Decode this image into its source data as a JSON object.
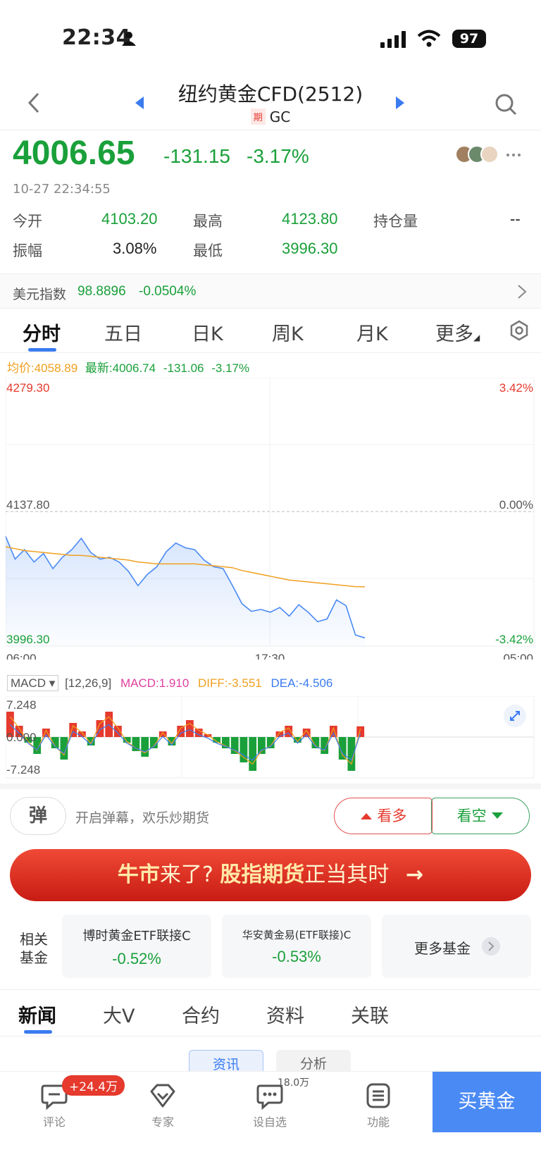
{
  "status_bar": {
    "time": "22:34",
    "battery": "97"
  },
  "nav": {
    "title": "纽约黄金CFD(2512)",
    "badge": "期",
    "code": "GC"
  },
  "quote": {
    "price": "4006.65",
    "change": "-131.15",
    "change_pct": "-3.17%",
    "timestamp": "10-27 22:34:55",
    "stats": [
      {
        "label": "今开",
        "value": "4103.20"
      },
      {
        "label": "最高",
        "value": "4123.80"
      },
      {
        "label": "持仓量",
        "value": "--"
      },
      {
        "label": "振幅",
        "value": "3.08%"
      },
      {
        "label": "最低",
        "value": "3996.30"
      }
    ]
  },
  "dollar_index": {
    "label": "美元指数",
    "value": "98.8896",
    "change_pct": "-0.0504%"
  },
  "tabs": [
    "分时",
    "五日",
    "日K",
    "周K",
    "月K",
    "更多"
  ],
  "legend": {
    "avg": "均价:4058.89",
    "latest": "最新:4006.74",
    "chg": "-131.06",
    "pct": "-3.17%"
  },
  "chart_data": [
    {
      "type": "line",
      "series": [
        {
          "name": "最新",
          "values": [
            4112,
            4088,
            4098,
            4085,
            4094,
            4078,
            4090,
            4098,
            4110,
            4095,
            4088,
            4090,
            4085,
            4075,
            4060,
            4072,
            4080,
            4096,
            4105,
            4100,
            4098,
            4087,
            4080,
            4078,
            4060,
            4041,
            4033,
            4035,
            4032,
            4037,
            4028,
            4040,
            4032,
            4022,
            4025,
            4045,
            4039,
            4008,
            4005
          ]
        },
        {
          "name": "均价",
          "values": [
            4101,
            4099,
            4097,
            4096,
            4095,
            4094,
            4093,
            4092,
            4092,
            4091,
            4090,
            4089,
            4088,
            4087,
            4085,
            4084,
            4083,
            4083,
            4083,
            4083,
            4083,
            4082,
            4081,
            4080,
            4079,
            4076,
            4074,
            4072,
            4070,
            4068,
            4066,
            4065,
            4064,
            4063,
            4062,
            4061,
            4060,
            4059,
            4058.89
          ]
        }
      ],
      "y_labels_left": [
        "4279.30",
        "4137.80",
        "3996.30"
      ],
      "y_labels_right": [
        "3.42%",
        "0.00%",
        "-3.42%"
      ],
      "x_labels": [
        "06:00",
        "17:30",
        "05:00"
      ],
      "ylim": [
        3996.3,
        4279.3
      ]
    },
    {
      "type": "bar",
      "indicator": "MACD",
      "params": "[12,26,9]",
      "macd": "MACD:1.910",
      "diff": "DIFF:-3.551",
      "dea": "DEA:-4.506",
      "y_labels": [
        "7.248",
        "0.000",
        "-7.248"
      ],
      "ylim": [
        -7.248,
        7.248
      ],
      "values": [
        4.5,
        2,
        -1,
        -3,
        1.5,
        -2,
        -4,
        2.5,
        1,
        -1.5,
        3,
        4.5,
        2,
        -1,
        -2.5,
        -3.5,
        -2,
        1,
        -1.5,
        2,
        3,
        1.5,
        0.5,
        -1,
        -2,
        -3,
        -4.5,
        -6,
        -3,
        -2,
        1,
        2,
        -1,
        1.5,
        -2,
        -3,
        2,
        -4,
        -6,
        1.9
      ]
    }
  ],
  "danmaku": {
    "icon_text": "弹",
    "placeholder": "开启弹幕，欢乐炒期货",
    "bull": "看多",
    "bear": "看空"
  },
  "banner": {
    "p1": "牛市",
    "p2": "来了?",
    "p3": "股指期货",
    "p4": "正当其时",
    "arrow": "→"
  },
  "funds": {
    "label1": "相关",
    "label2": "基金",
    "items": [
      {
        "name": "博时黄金ETF联接C",
        "pct": "-0.52%"
      },
      {
        "name": "华安黄金易(ETF联接)C",
        "pct": "-0.53%"
      }
    ],
    "more": "更多基金"
  },
  "news_tabs": [
    "新闻",
    "大V",
    "合约",
    "资料",
    "关联"
  ],
  "sub_tabs": [
    "资讯",
    "分析"
  ],
  "bottom_bar": {
    "comment": "评论",
    "comment_badge": "+24.4万",
    "expert": "专家",
    "watch": "设自选",
    "watch_badge": "18.0万",
    "func": "功能",
    "buy": "买黄金"
  }
}
